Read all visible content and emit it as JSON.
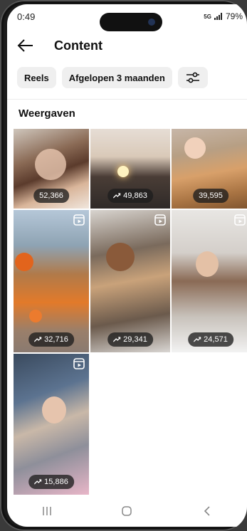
{
  "status": {
    "time": "0:49",
    "network": "5G",
    "battery": "79%"
  },
  "header": {
    "title": "Content"
  },
  "filters": {
    "type_label": "Reels",
    "period_label": "Afgelopen 3 maanden"
  },
  "section": {
    "heading": "Weergaven"
  },
  "tiles": [
    {
      "views": "52,366",
      "trend": false,
      "reel": false
    },
    {
      "views": "49,863",
      "trend": true,
      "reel": false
    },
    {
      "views": "39,595",
      "trend": false,
      "reel": false
    },
    {
      "views": "32,716",
      "trend": true,
      "reel": true
    },
    {
      "views": "29,341",
      "trend": true,
      "reel": true
    },
    {
      "views": "24,571",
      "trend": true,
      "reel": true
    },
    {
      "views": "15,886",
      "trend": true,
      "reel": true
    }
  ],
  "icons": {
    "back": "arrow-left-icon",
    "filter": "sliders-icon",
    "trend": "trending-up-icon",
    "reel": "reel-icon",
    "nav_recents": "recents-icon",
    "nav_home": "home-circle-icon",
    "nav_back": "chevron-left-icon"
  }
}
